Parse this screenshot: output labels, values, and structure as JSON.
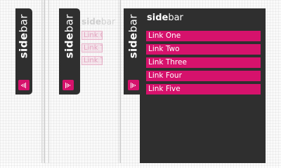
{
  "sidebar": {
    "title_bold": "side",
    "title_light": "bar",
    "links": [
      "Link One",
      "Link Two",
      "Link Three",
      "Link Four",
      "Link Five"
    ]
  },
  "toggle_icon": "handle-icon",
  "colors": {
    "panel_bg": "#2f2f2f",
    "accent": "#d6126c",
    "text": "#ffffff"
  }
}
